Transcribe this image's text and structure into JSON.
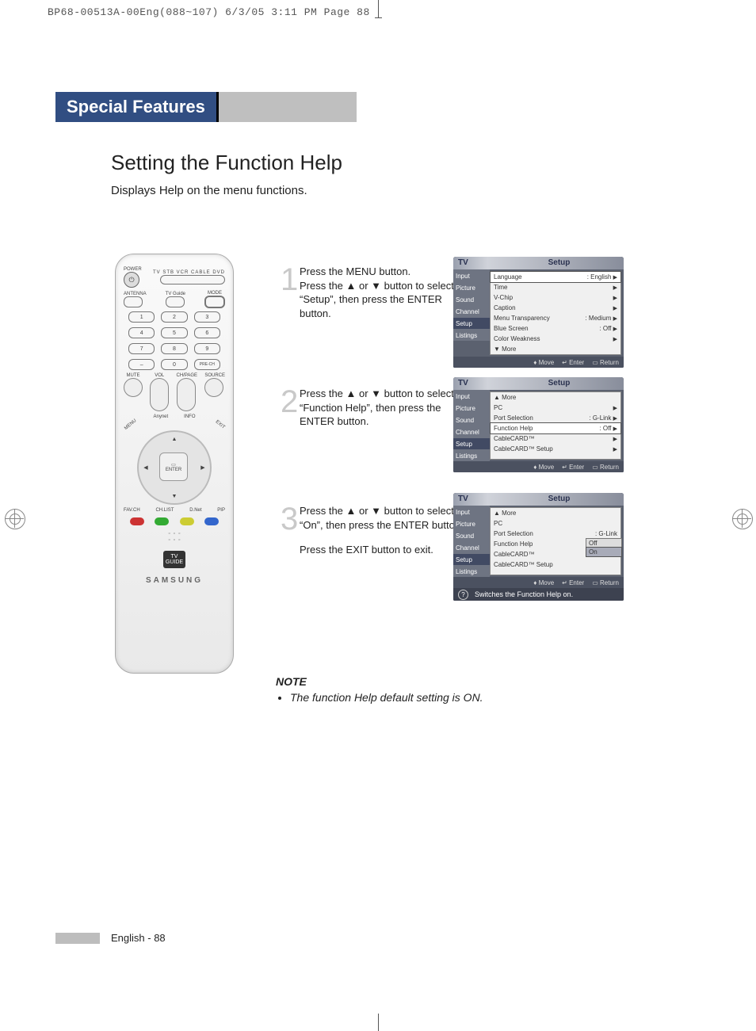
{
  "cropInfo": "BP68-00513A-00Eng(088~107)  6/3/05  3:11 PM  Page 88",
  "headingBar": "Special Features",
  "sectionTitle": "Setting the Function Help",
  "sectionSubtitle": "Displays Help on the menu functions.",
  "remote": {
    "powerLabel": "POWER",
    "modeLabels": "TV  STB  VCR  CABLE  DVD",
    "row2L": "ANTENNA",
    "row2C": "TV Guide",
    "row2R": "MODE",
    "volLabel": "VOL",
    "chLabel": "CH/PAGE",
    "muteLabel": "MUTE",
    "sourceLabel": "SOURCE",
    "anynetLabel": "Anynet",
    "infoLabel": "INFO",
    "menuLabel": "MENU",
    "exitLabel": "EXIT",
    "enterLabel": "ENTER",
    "favLabel": "FAV.CH",
    "chlistLabel": "CH.LIST",
    "dnietLabel": "D.Net",
    "pipLabel": "PIP",
    "preChLabel": "PRE-CH",
    "tvGuideLogo": "TV GUIDE",
    "brand": "SAMSUNG"
  },
  "steps": {
    "s1": {
      "num": "1",
      "text": "Press the MENU button.\nPress the ▲ or ▼ button to select “Setup”, then press the ENTER button."
    },
    "s2": {
      "num": "2",
      "text": "Press the ▲ or ▼ button to select “Function Help”, then press the ENTER button."
    },
    "s3": {
      "num": "3",
      "text": "Press the ▲ or ▼ button to select “On”, then press the ENTER button.",
      "text2": "Press the EXIT button to exit."
    }
  },
  "osdCommon": {
    "tv": "TV",
    "title": "Setup",
    "sidebar": [
      "Input",
      "Picture",
      "Sound",
      "Channel",
      "Setup",
      "Listings"
    ],
    "footMove": "Move",
    "footEnter": "Enter",
    "footReturn": "Return"
  },
  "osd1": {
    "rows": [
      {
        "l": "Language",
        "r": ": English",
        "arrow": true,
        "hl": true
      },
      {
        "l": "Time",
        "r": "",
        "arrow": true
      },
      {
        "l": "V-Chip",
        "r": "",
        "arrow": true
      },
      {
        "l": "Caption",
        "r": "",
        "arrow": true
      },
      {
        "l": "Menu Transparency",
        "r": ": Medium",
        "arrow": true
      },
      {
        "l": "Blue Screen",
        "r": ": Off",
        "arrow": true
      },
      {
        "l": "Color Weakness",
        "r": "",
        "arrow": true
      },
      {
        "l": "▼ More",
        "r": "",
        "arrow": false
      }
    ]
  },
  "osd2": {
    "rows": [
      {
        "l": "▲ More",
        "r": "",
        "arrow": false
      },
      {
        "l": "PC",
        "r": "",
        "arrow": true
      },
      {
        "l": "Port Selection",
        "r": ": G-Link",
        "arrow": true
      },
      {
        "l": "Function Help",
        "r": ": Off",
        "arrow": true,
        "hl": true
      },
      {
        "l": "CableCARD™",
        "r": "",
        "arrow": true
      },
      {
        "l": "CableCARD™ Setup",
        "r": "",
        "arrow": true
      }
    ]
  },
  "osd3": {
    "rows": [
      {
        "l": "▲ More",
        "r": "",
        "arrow": false
      },
      {
        "l": "PC",
        "r": "",
        "arrow": false
      },
      {
        "l": "Port Selection",
        "r": ": G-Link",
        "arrow": false
      },
      {
        "l": "Function Help",
        "r": "",
        "arrow": false,
        "dd": true
      },
      {
        "l": "CableCARD™",
        "r": "",
        "arrow": false
      },
      {
        "l": "CableCARD™ Setup",
        "r": "",
        "arrow": false
      }
    ],
    "ddOptions": {
      "off": "Off",
      "on": "On"
    },
    "helpLine": "Switches the Function Help on."
  },
  "note": {
    "heading": "NOTE",
    "item": "The function Help default setting is ON."
  },
  "footer": "English - 88"
}
